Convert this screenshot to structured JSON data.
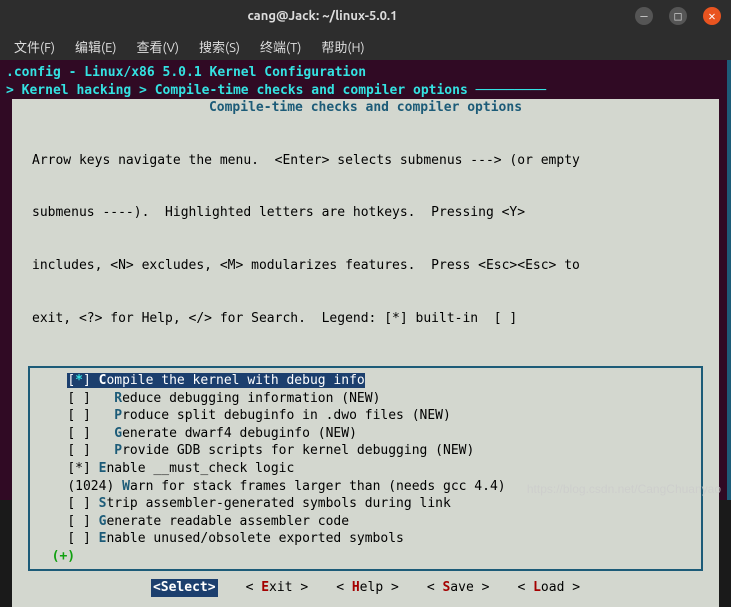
{
  "window": {
    "title": "cang@Jack: ~/linux-5.0.1"
  },
  "menubar": {
    "file": "文件(F)",
    "edit": "编辑(E)",
    "view": "查看(V)",
    "search": "搜索(S)",
    "terminal": "终端(T)",
    "help": "帮助(H)"
  },
  "header": {
    "config": ".config - Linux/x86 5.0.1 Kernel Configuration",
    "breadcrumb_prefix": "> ",
    "breadcrumb_a": "Kernel hacking",
    "breadcrumb_sep": " > ",
    "breadcrumb_b": "Compile-time checks and compiler options",
    "dashes": " ─────────"
  },
  "dialog": {
    "title": "Compile-time checks and compiler options",
    "help1": "Arrow keys navigate the menu.  <Enter> selects submenus ---> (or empty",
    "help2": "submenus ----).  Highlighted letters are hotkeys.  Pressing <Y>",
    "help3": "includes, <N> excludes, <M> modularizes features.  Press <Esc><Esc> to",
    "help4": "exit, <?> for Help, </> for Search.  Legend: [*] built-in  [ ]"
  },
  "options": [
    {
      "prefix": "[",
      "mark": "*",
      "mid": "] ",
      "hot": "C",
      "label": "ompile the kernel with debug info",
      "highlight": true
    },
    {
      "prefix": "[ ]   ",
      "hot": "R",
      "label": "educe debugging information (NEW)"
    },
    {
      "prefix": "[ ]   ",
      "hot": "P",
      "label": "roduce split debuginfo in .dwo files (NEW)"
    },
    {
      "prefix": "[ ]   ",
      "hot": "G",
      "label": "enerate dwarf4 debuginfo (NEW)"
    },
    {
      "prefix": "[ ]   ",
      "hot": "P",
      "label": "rovide GDB scripts for kernel debugging (NEW)"
    },
    {
      "prefix": "[*] ",
      "hot": "E",
      "label": "nable __must_check logic"
    },
    {
      "prefix": "(1024) ",
      "hot": "W",
      "label": "arn for stack frames larger than (needs gcc 4.4)"
    },
    {
      "prefix": "[ ] ",
      "hot": "S",
      "label": "trip assembler-generated symbols during link"
    },
    {
      "prefix": "[ ] ",
      "hot": "G",
      "label": "enerate readable assembler code"
    },
    {
      "prefix": "[ ] ",
      "hot": "E",
      "label": "nable unused/obsolete exported symbols"
    }
  ],
  "scroll_indicator": "(+)",
  "buttons": {
    "select": "<Select>",
    "exit_open": "< ",
    "exit_hot": "E",
    "exit_rest": "xit >",
    "help_open": "< ",
    "help_hot": "H",
    "help_rest": "elp >",
    "save_open": "< ",
    "save_hot": "S",
    "save_rest": "ave >",
    "load_open": "< ",
    "load_hot": "L",
    "load_rest": "oad >"
  },
  "watermark": "https://blog.csdn.net/CangChuanyao"
}
